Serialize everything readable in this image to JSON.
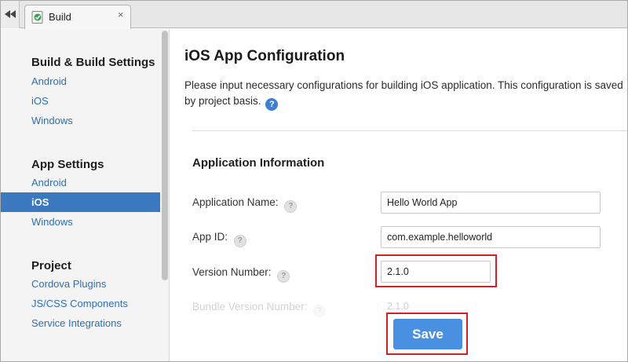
{
  "tab": {
    "label": "Build",
    "close": "×",
    "icon": "build-doc-icon"
  },
  "sidebar": {
    "sections": [
      {
        "title": "Build & Build Settings",
        "items": [
          "Android",
          "iOS",
          "Windows"
        ]
      },
      {
        "title": "App Settings",
        "items": [
          "Android",
          "iOS",
          "Windows"
        ]
      },
      {
        "title": "Project",
        "items": [
          "Cordova Plugins",
          "JS/CSS Components",
          "Service Integrations"
        ]
      }
    ],
    "active": "App Settings / iOS"
  },
  "main": {
    "title": "iOS App Configuration",
    "description": "Please input necessary configurations for building iOS application. This configuration is saved by project basis.",
    "help_glyph": "?",
    "section_title": "Application Information",
    "fields": [
      {
        "label": "Application Name:",
        "value": "Hello World App"
      },
      {
        "label": "App ID:",
        "value": "com.example.helloworld"
      },
      {
        "label": "Version Number:",
        "value": "2.1.0"
      },
      {
        "label": "Bundle Version Number:",
        "value": "2.1.0"
      }
    ],
    "save_label": "Save"
  },
  "colors": {
    "accent": "#3c78c0",
    "link": "#2e6fb3",
    "save_button": "#4a90e2",
    "highlight": "#d0202a"
  }
}
